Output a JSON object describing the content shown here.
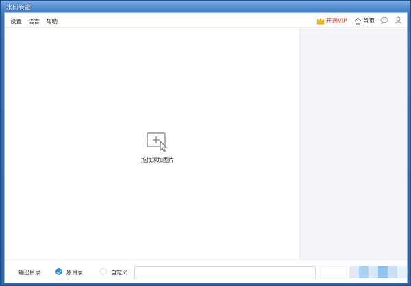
{
  "window": {
    "title": "水印管家"
  },
  "menu": {
    "settings": "设置",
    "language": "语言",
    "help": "帮助"
  },
  "header": {
    "vip_label": "开通VIP",
    "home_label": "首页"
  },
  "drop_area": {
    "label": "拖拽添加图片"
  },
  "footer": {
    "output_label": "输出目录",
    "option_source": "原目录",
    "option_custom": "自定义",
    "selected_option": "原目录",
    "path_value": ""
  },
  "colors": {
    "accent": "#2a8be0",
    "vip_text": "#e4402e",
    "vip_crown": "#f5b800",
    "panel_bg": "#f3f4f8"
  },
  "icons": {
    "vip": "crown-icon",
    "home": "home-icon",
    "chat": "chat-bubble-icon",
    "user": "user-icon",
    "drop": "add-image-cursor-icon"
  }
}
